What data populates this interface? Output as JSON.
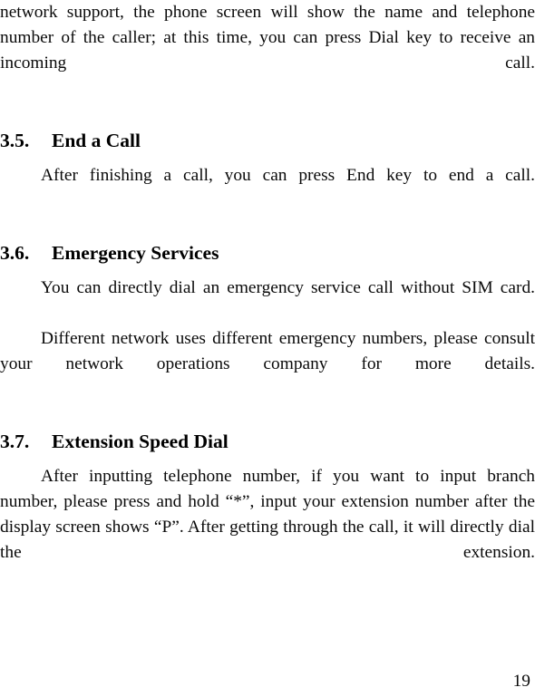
{
  "document": {
    "type": "user-manual-page",
    "page_number": "19",
    "body_text_color": "#0a0a0a",
    "background_color": "#ffffff"
  },
  "blocks": {
    "continued_paragraph": "network support, the phone screen will show the name and telephone number of the caller; at this time, you can press Dial key to receive an incoming call.",
    "section_3_5": {
      "number": "3.5.",
      "title": "End a Call",
      "paragraph": "After finishing a call, you can press End key to end a call."
    },
    "section_3_6": {
      "number": "3.6.",
      "title": "Emergency Services",
      "paragraph_1": "You can directly dial an emergency service call without SIM card.",
      "paragraph_2": "Different network uses different emergency numbers, please consult your network operations company for more details."
    },
    "section_3_7": {
      "number": "3.7.",
      "title": "Extension Speed Dial",
      "paragraph": "After inputting telephone number, if you want to input branch number, please press and hold “*”, input your extension number after the display screen shows “P”. After getting through the call, it will directly dial the extension."
    }
  }
}
